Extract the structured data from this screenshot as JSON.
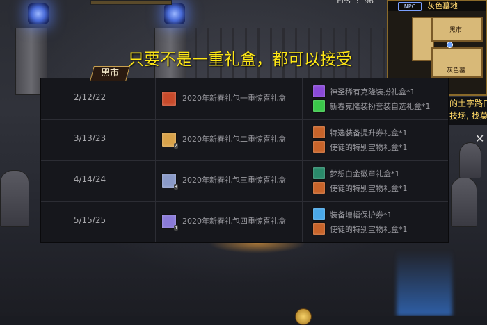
{
  "hud": {
    "fps": "FPS : 96",
    "minimap_title": "灰色墓地",
    "minimap_npc": "NPC",
    "minimap_labels": [
      "黑市",
      "灰色墓"
    ],
    "chat_lines": [
      "的土字路口",
      "技场, 找莫"
    ]
  },
  "overlay": {
    "headline": "只要不是一重礼盒，都可以接受",
    "tag": "黑市"
  },
  "rows": [
    {
      "date": "2/12/22",
      "box": "2020年新春礼包一重惊喜礼盒",
      "box_color": "#c84a2a",
      "box_num": "",
      "rewards": [
        {
          "name": "神圣稀有克隆装扮礼盒*1",
          "color": "#8a4ad8"
        },
        {
          "name": "新春克隆装扮套装自选礼盒*1",
          "color": "#3ac84a"
        }
      ]
    },
    {
      "date": "3/13/23",
      "box": "2020年新春礼包二重惊喜礼盒",
      "box_color": "#d8a24a",
      "box_num": "2",
      "rewards": [
        {
          "name": "特选装备提升券礼盒*1",
          "color": "#c8642a"
        },
        {
          "name": "使徒的特别宝物礼盒*1",
          "color": "#c8642a"
        }
      ]
    },
    {
      "date": "4/14/24",
      "box": "2020年新春礼包三重惊喜礼盒",
      "box_color": "#8a9ac8",
      "box_num": "3",
      "rewards": [
        {
          "name": "梦想白金徽章礼盒*1",
          "color": "#2a8a6a"
        },
        {
          "name": "使徒的特别宝物礼盒*1",
          "color": "#c8642a"
        }
      ]
    },
    {
      "date": "5/15/25",
      "box": "2020年新春礼包四重惊喜礼盒",
      "box_color": "#8a7ad8",
      "box_num": "4",
      "rewards": [
        {
          "name": "装备增幅保护券*1",
          "color": "#4aa8e8"
        },
        {
          "name": "使徒的特别宝物礼盒*1",
          "color": "#c8642a"
        }
      ]
    }
  ]
}
